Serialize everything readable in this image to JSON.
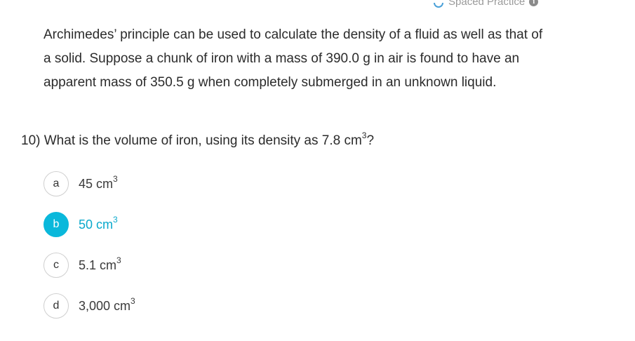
{
  "header": {
    "spaced_practice_label": "Spaced Practice",
    "info_icon": "info-icon",
    "arc_icon": "refresh-arc-icon"
  },
  "passage": {
    "text": "Archimedes’ principle can be used to calculate the density of a fluid as well as that of a solid. Suppose a chunk of iron with a mass of 390.0 g in air is found to have an apparent mass of 350.5 g when completely submerged in an unknown liquid."
  },
  "question": {
    "number": "10)",
    "text": "What is the volume of iron, using its density as 7.8 cm",
    "superscript": "3",
    "suffix": "?"
  },
  "choices": [
    {
      "letter": "a",
      "value": "45 cm",
      "exp": "3",
      "selected": false
    },
    {
      "letter": "b",
      "value": "50 cm",
      "exp": "3",
      "selected": true
    },
    {
      "letter": "c",
      "value": "5.1 cm",
      "exp": "3",
      "selected": false
    },
    {
      "letter": "d",
      "value": "3,000 cm",
      "exp": "3",
      "selected": false
    }
  ],
  "colors": {
    "selected_accent": "#0ab8db",
    "selected_text": "#0aa9cc",
    "muted": "#9a9a9a"
  }
}
